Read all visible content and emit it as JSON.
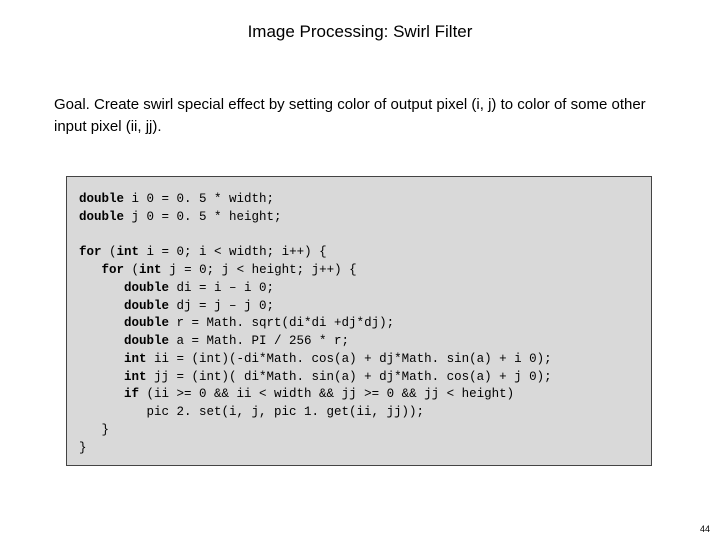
{
  "title": "Image Processing:  Swirl Filter",
  "goal": {
    "label": "Goal.",
    "text": " Create swirl special effect by setting color of output pixel (i, j) to color of some other input pixel (ii, jj)."
  },
  "code": {
    "kw_double": "double",
    "kw_for": "for",
    "kw_int": "int",
    "kw_if": "if",
    "l1_a": " i 0 = 0. 5 * width;",
    "l2_a": " j 0 = 0. 5 * height;",
    "l4_a": " (",
    "l4_b": " i = 0; i < width; i++) {",
    "l5_a": "   ",
    "l5_b": " (",
    "l5_c": " j = 0; j < height; j++) {",
    "l6_a": "      ",
    "l6_b": " di = i – i 0;",
    "l7_a": "      ",
    "l7_b": " dj = j – j 0;",
    "l8_a": "      ",
    "l8_b": " r = Math. sqrt(di*di +dj*dj);",
    "l9_a": "      ",
    "l9_b": " a = Math. PI / 256 * r;",
    "l10_a": "      ",
    "l10_b": " ii = (int)(-di*Math. cos(a) + dj*Math. sin(a) + i 0);",
    "l11_a": "      ",
    "l11_b": " jj = (int)( di*Math. sin(a) + dj*Math. cos(a) + j 0);",
    "l12_a": "      ",
    "l12_b": " (ii >= 0 && ii < width && jj >= 0 && jj < height)",
    "l13": "         pic 2. set(i, j, pic 1. get(ii, jj));",
    "l14": "   }",
    "l15": "}"
  },
  "pagenum": "44"
}
